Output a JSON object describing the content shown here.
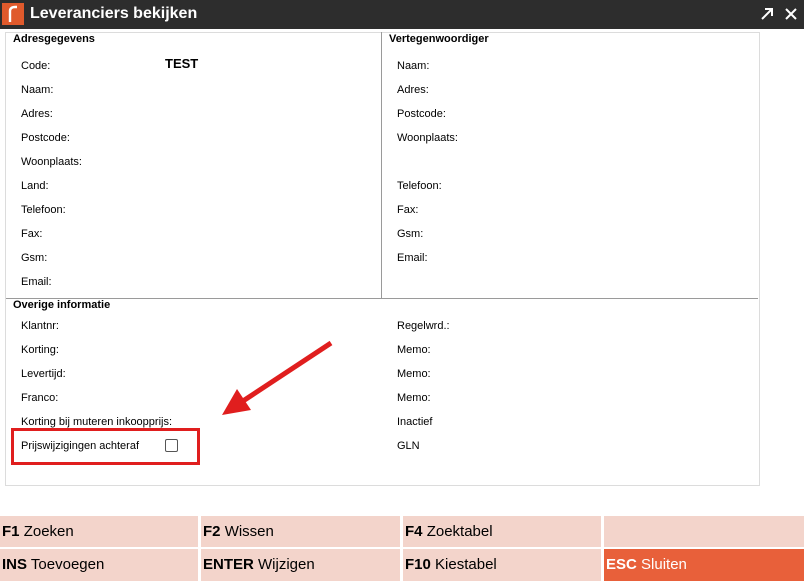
{
  "window": {
    "title": "Leveranciers bekijken"
  },
  "address": {
    "heading": "Adresgegevens",
    "labels": [
      "Code:",
      "Naam:",
      "Adres:",
      "Postcode:",
      "Woonplaats:",
      "Land:",
      "Telefoon:",
      "Fax:",
      "Gsm:",
      "Email:"
    ],
    "code_value": "TEST"
  },
  "rep": {
    "heading": "Vertegenwoordiger",
    "labels_top": [
      "Naam:",
      "Adres:",
      "Postcode:",
      "Woonplaats:"
    ],
    "labels_bottom": [
      "Telefoon:",
      "Fax:",
      "Gsm:",
      "Email:"
    ]
  },
  "other": {
    "heading": "Overige informatie",
    "left_labels": [
      "Klantnr:",
      "Korting:",
      "Levertijd:",
      "Franco:",
      "Korting bij muteren inkoopprijs:"
    ],
    "checkbox_label": "Prijswijzigingen achteraf",
    "checkbox_checked": false,
    "right_labels": [
      "Regelwrd.:",
      "Memo:",
      "Memo:",
      "Memo:",
      "Inactief",
      "GLN"
    ]
  },
  "function_keys": [
    {
      "key": "F1",
      "label": "Zoeken"
    },
    {
      "key": "F2",
      "label": "Wissen"
    },
    {
      "key": "F4",
      "label": "Zoektabel"
    },
    {
      "key": "",
      "label": ""
    },
    {
      "key": "INS",
      "label": "Toevoegen"
    },
    {
      "key": "ENTER",
      "label": "Wijzigen"
    },
    {
      "key": "F10",
      "label": "Kiestabel"
    },
    {
      "key": "ESC",
      "label": "Sluiten"
    }
  ],
  "colors": {
    "accent": "#e8603a",
    "fkey_bg": "#f3d4cb",
    "titlebar": "#2d2d2d",
    "annotation": "#e01e1e"
  }
}
